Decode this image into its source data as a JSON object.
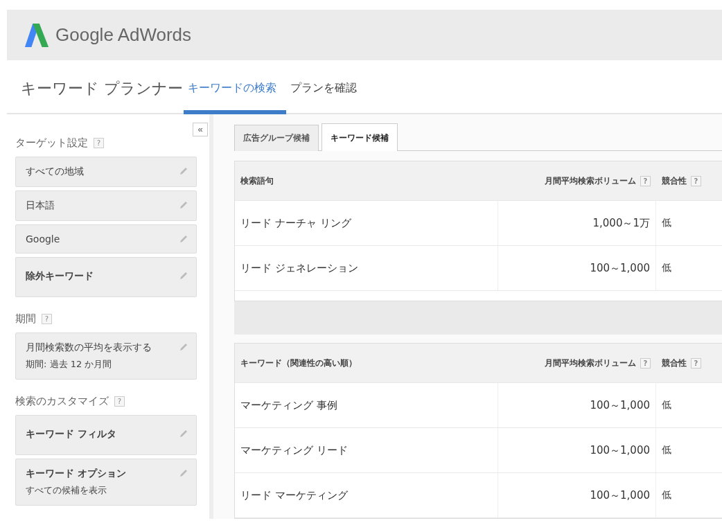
{
  "header": {
    "logo_text": "Google AdWords"
  },
  "page_title": "キーワード プランナー",
  "nav_tabs": [
    {
      "label": "キーワードの検索",
      "selected": true
    },
    {
      "label": "プランを確認",
      "selected": false
    }
  ],
  "collapse_button": "«",
  "sidebar": {
    "sections": [
      {
        "title": "ターゲット設定",
        "help": "?",
        "items": [
          {
            "label": "すべての地域",
            "bold": false,
            "tall": false
          },
          {
            "label": "日本語",
            "bold": false,
            "tall": false
          },
          {
            "label": "Google",
            "bold": false,
            "tall": false
          },
          {
            "label": "除外キーワード",
            "bold": true,
            "tall": true
          }
        ]
      },
      {
        "title": "期間",
        "help": "?",
        "items": [
          {
            "label": "月間検索数の平均を表示する",
            "sub": "期間: 過去 12 か月間",
            "bold": false,
            "tall": false
          }
        ]
      },
      {
        "title": "検索のカスタマイズ",
        "help": "?",
        "items": [
          {
            "label": "キーワード フィルタ",
            "bold": true,
            "tall": true
          },
          {
            "label": "キーワード オプション",
            "sub": "すべての候補を表示",
            "bold": true,
            "tall": false
          }
        ]
      }
    ]
  },
  "sub_tabs": [
    {
      "label": "広告グループ候補",
      "selected": false
    },
    {
      "label": "キーワード候補",
      "selected": true
    }
  ],
  "tables": [
    {
      "columns": [
        {
          "label": "検索語句"
        },
        {
          "label": "月間平均検索ボリューム",
          "help": "?"
        },
        {
          "label": "競合性",
          "help": "?"
        }
      ],
      "rows": [
        [
          "リード ナーチャ リング",
          "1,000～1万",
          "低"
        ],
        [
          "リード ジェネレーション",
          "100～1,000",
          "低"
        ]
      ]
    },
    {
      "columns": [
        {
          "label": "キーワード（関連性の高い順）"
        },
        {
          "label": "月間平均検索ボリューム",
          "help": "?"
        },
        {
          "label": "競合性",
          "help": "?"
        }
      ],
      "rows": [
        [
          "マーケティング 事例",
          "100～1,000",
          "低"
        ],
        [
          "マーケティング リード",
          "100～1,000",
          "低"
        ],
        [
          "リード マーケティング",
          "100～1,000",
          "低"
        ]
      ]
    }
  ]
}
